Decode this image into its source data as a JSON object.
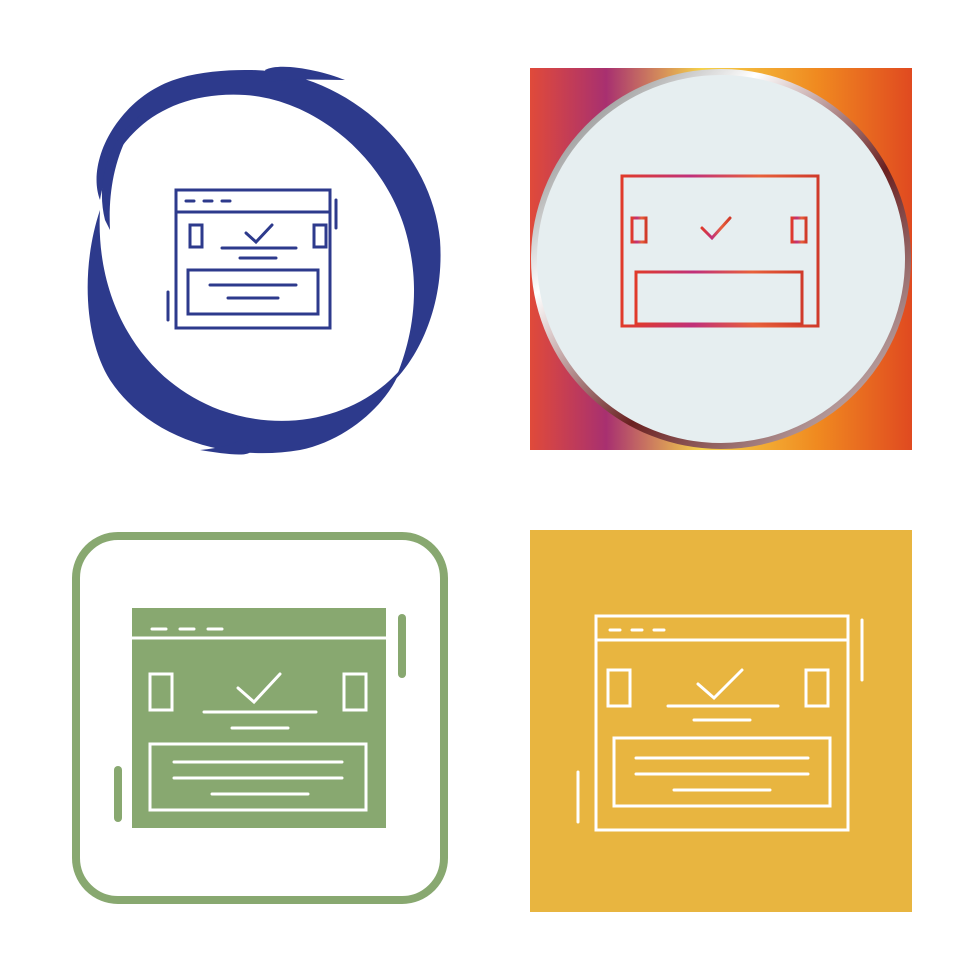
{
  "icon_name": "browser-check-icon",
  "variants": [
    {
      "style": "blue-swirl-circle",
      "accent": "#2d3a8c"
    },
    {
      "style": "gradient-square-circle",
      "accent": "#d84a2a",
      "gradient": [
        "#e04a3a",
        "#a83070",
        "#f5d24a",
        "#f08a20",
        "#e04a20"
      ],
      "circle_fill": "#e6eef0"
    },
    {
      "style": "green-rounded-square",
      "accent": "#88a870",
      "line": "#ffffff"
    },
    {
      "style": "yellow-square",
      "accent": "#e8b540",
      "line": "#ffffff"
    }
  ]
}
